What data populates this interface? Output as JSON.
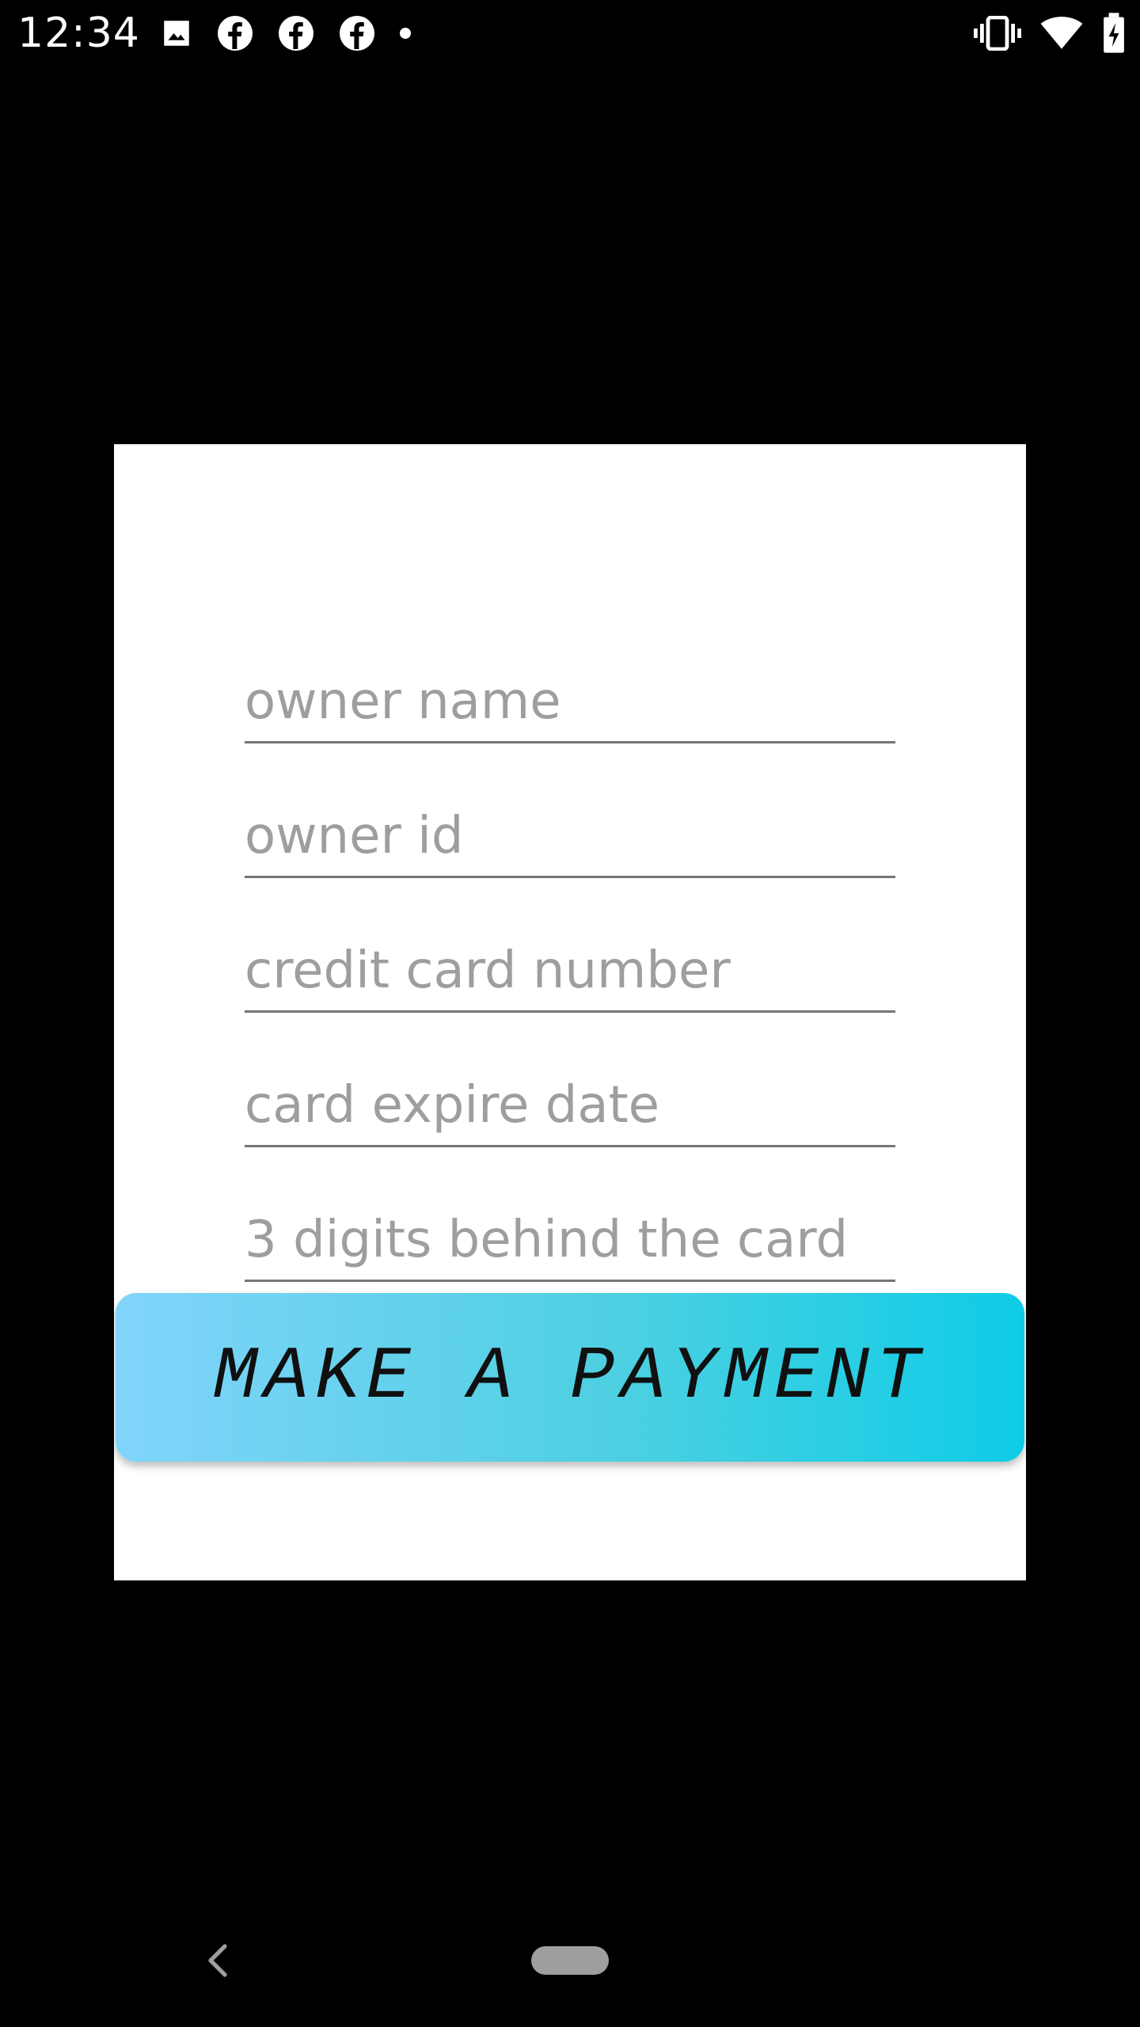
{
  "status_bar": {
    "time": "12:34",
    "left_icons": [
      "image-icon",
      "facebook-icon",
      "facebook-icon",
      "facebook-icon",
      "notification-dot-icon"
    ],
    "right_icons": [
      "vibrate-icon",
      "wifi-icon",
      "battery-charging-icon"
    ]
  },
  "form": {
    "owner_name_placeholder": "owner name",
    "owner_id_placeholder": "owner id",
    "card_number_placeholder": "credit card number",
    "expire_date_placeholder": "card expire date",
    "cvv_placeholder": "3 digits behind the card",
    "submit_label": "MAKE A PAYMENT"
  },
  "colors": {
    "button_gradient_start": "#81d4fa",
    "button_gradient_end": "#0ecce6",
    "placeholder": "#9e9e9e",
    "underline": "#757575"
  },
  "nav_bar": {
    "icons": [
      "back-icon",
      "home-pill-icon"
    ]
  }
}
